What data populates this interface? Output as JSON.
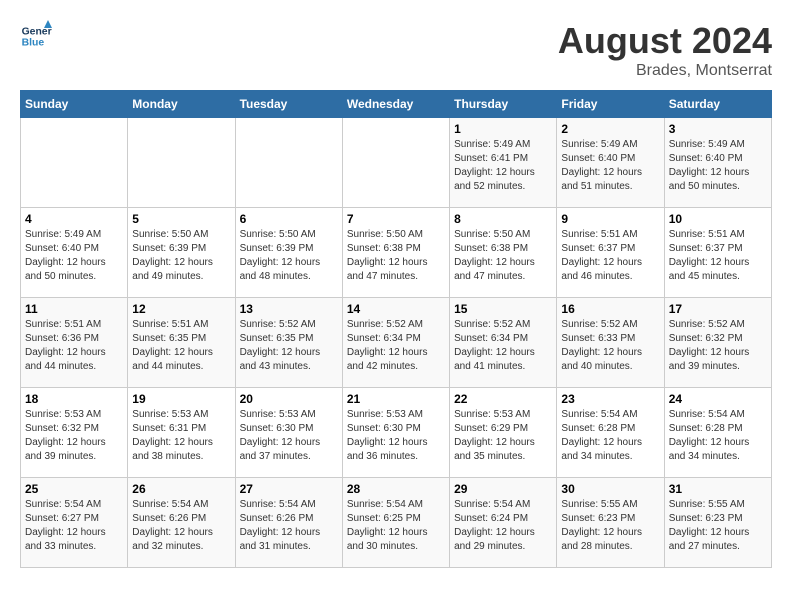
{
  "header": {
    "logo_line1": "General",
    "logo_line2": "Blue",
    "title": "August 2024",
    "subtitle": "Brades, Montserrat"
  },
  "weekdays": [
    "Sunday",
    "Monday",
    "Tuesday",
    "Wednesday",
    "Thursday",
    "Friday",
    "Saturday"
  ],
  "weeks": [
    [
      {
        "day": "",
        "info": ""
      },
      {
        "day": "",
        "info": ""
      },
      {
        "day": "",
        "info": ""
      },
      {
        "day": "",
        "info": ""
      },
      {
        "day": "1",
        "info": "Sunrise: 5:49 AM\nSunset: 6:41 PM\nDaylight: 12 hours\nand 52 minutes."
      },
      {
        "day": "2",
        "info": "Sunrise: 5:49 AM\nSunset: 6:40 PM\nDaylight: 12 hours\nand 51 minutes."
      },
      {
        "day": "3",
        "info": "Sunrise: 5:49 AM\nSunset: 6:40 PM\nDaylight: 12 hours\nand 50 minutes."
      }
    ],
    [
      {
        "day": "4",
        "info": "Sunrise: 5:49 AM\nSunset: 6:40 PM\nDaylight: 12 hours\nand 50 minutes."
      },
      {
        "day": "5",
        "info": "Sunrise: 5:50 AM\nSunset: 6:39 PM\nDaylight: 12 hours\nand 49 minutes."
      },
      {
        "day": "6",
        "info": "Sunrise: 5:50 AM\nSunset: 6:39 PM\nDaylight: 12 hours\nand 48 minutes."
      },
      {
        "day": "7",
        "info": "Sunrise: 5:50 AM\nSunset: 6:38 PM\nDaylight: 12 hours\nand 47 minutes."
      },
      {
        "day": "8",
        "info": "Sunrise: 5:50 AM\nSunset: 6:38 PM\nDaylight: 12 hours\nand 47 minutes."
      },
      {
        "day": "9",
        "info": "Sunrise: 5:51 AM\nSunset: 6:37 PM\nDaylight: 12 hours\nand 46 minutes."
      },
      {
        "day": "10",
        "info": "Sunrise: 5:51 AM\nSunset: 6:37 PM\nDaylight: 12 hours\nand 45 minutes."
      }
    ],
    [
      {
        "day": "11",
        "info": "Sunrise: 5:51 AM\nSunset: 6:36 PM\nDaylight: 12 hours\nand 44 minutes."
      },
      {
        "day": "12",
        "info": "Sunrise: 5:51 AM\nSunset: 6:35 PM\nDaylight: 12 hours\nand 44 minutes."
      },
      {
        "day": "13",
        "info": "Sunrise: 5:52 AM\nSunset: 6:35 PM\nDaylight: 12 hours\nand 43 minutes."
      },
      {
        "day": "14",
        "info": "Sunrise: 5:52 AM\nSunset: 6:34 PM\nDaylight: 12 hours\nand 42 minutes."
      },
      {
        "day": "15",
        "info": "Sunrise: 5:52 AM\nSunset: 6:34 PM\nDaylight: 12 hours\nand 41 minutes."
      },
      {
        "day": "16",
        "info": "Sunrise: 5:52 AM\nSunset: 6:33 PM\nDaylight: 12 hours\nand 40 minutes."
      },
      {
        "day": "17",
        "info": "Sunrise: 5:52 AM\nSunset: 6:32 PM\nDaylight: 12 hours\nand 39 minutes."
      }
    ],
    [
      {
        "day": "18",
        "info": "Sunrise: 5:53 AM\nSunset: 6:32 PM\nDaylight: 12 hours\nand 39 minutes."
      },
      {
        "day": "19",
        "info": "Sunrise: 5:53 AM\nSunset: 6:31 PM\nDaylight: 12 hours\nand 38 minutes."
      },
      {
        "day": "20",
        "info": "Sunrise: 5:53 AM\nSunset: 6:30 PM\nDaylight: 12 hours\nand 37 minutes."
      },
      {
        "day": "21",
        "info": "Sunrise: 5:53 AM\nSunset: 6:30 PM\nDaylight: 12 hours\nand 36 minutes."
      },
      {
        "day": "22",
        "info": "Sunrise: 5:53 AM\nSunset: 6:29 PM\nDaylight: 12 hours\nand 35 minutes."
      },
      {
        "day": "23",
        "info": "Sunrise: 5:54 AM\nSunset: 6:28 PM\nDaylight: 12 hours\nand 34 minutes."
      },
      {
        "day": "24",
        "info": "Sunrise: 5:54 AM\nSunset: 6:28 PM\nDaylight: 12 hours\nand 34 minutes."
      }
    ],
    [
      {
        "day": "25",
        "info": "Sunrise: 5:54 AM\nSunset: 6:27 PM\nDaylight: 12 hours\nand 33 minutes."
      },
      {
        "day": "26",
        "info": "Sunrise: 5:54 AM\nSunset: 6:26 PM\nDaylight: 12 hours\nand 32 minutes."
      },
      {
        "day": "27",
        "info": "Sunrise: 5:54 AM\nSunset: 6:26 PM\nDaylight: 12 hours\nand 31 minutes."
      },
      {
        "day": "28",
        "info": "Sunrise: 5:54 AM\nSunset: 6:25 PM\nDaylight: 12 hours\nand 30 minutes."
      },
      {
        "day": "29",
        "info": "Sunrise: 5:54 AM\nSunset: 6:24 PM\nDaylight: 12 hours\nand 29 minutes."
      },
      {
        "day": "30",
        "info": "Sunrise: 5:55 AM\nSunset: 6:23 PM\nDaylight: 12 hours\nand 28 minutes."
      },
      {
        "day": "31",
        "info": "Sunrise: 5:55 AM\nSunset: 6:23 PM\nDaylight: 12 hours\nand 27 minutes."
      }
    ]
  ]
}
